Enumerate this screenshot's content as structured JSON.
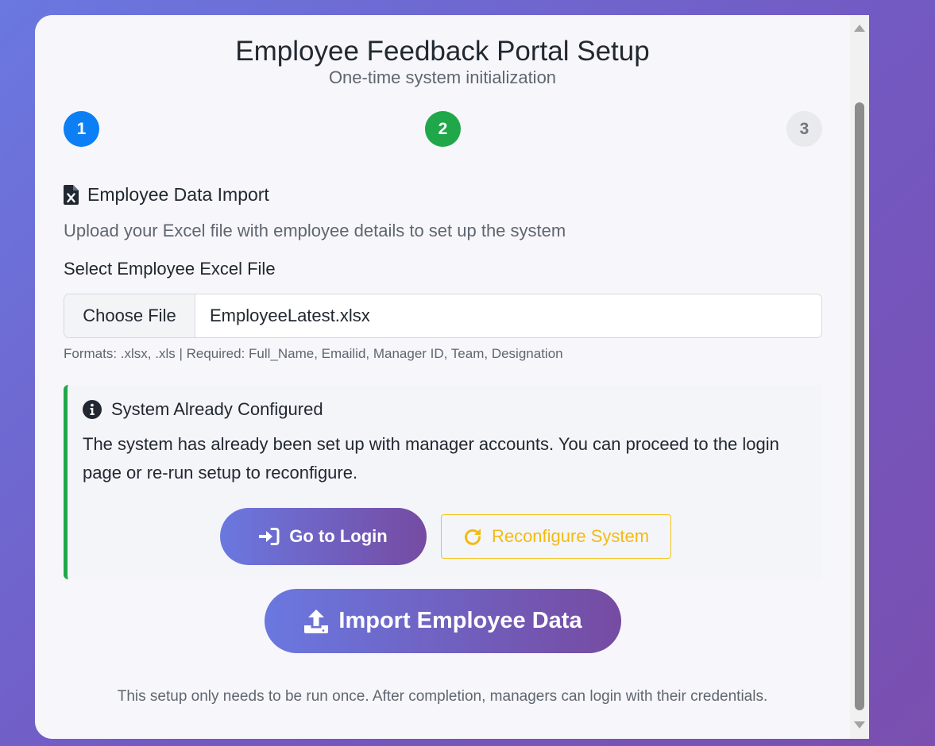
{
  "header": {
    "title": "Employee Feedback Portal Setup",
    "subtitle": "One-time system initialization"
  },
  "steps": [
    {
      "label": "1",
      "state": "active",
      "color": "#0d7ff5"
    },
    {
      "label": "2",
      "state": "completed",
      "color": "#20a74a"
    },
    {
      "label": "3",
      "state": "pending",
      "color": "#e8eaed"
    }
  ],
  "import_section": {
    "icon": "excel-file-icon",
    "heading": "Employee Data Import",
    "description": "Upload your Excel file with employee details to set up the system",
    "file_label": "Select Employee Excel File",
    "choose_file_label": "Choose File",
    "selected_file": "EmployeeLatest.xlsx",
    "hint": "Formats: .xlsx, .xls | Required: Full_Name, Emailid, Manager ID, Team, Designation"
  },
  "alert": {
    "icon": "info-circle-icon",
    "heading": "System Already Configured",
    "body": "The system has already been set up with manager accounts. You can proceed to the login page or re-run setup to reconfigure.",
    "login_button": "Go to Login",
    "login_icon": "sign-in-icon",
    "reconfigure_button": "Reconfigure System",
    "reconfigure_icon": "redo-icon",
    "accent_color": "#20a74a",
    "warning_color": "#f3bb10"
  },
  "import_button": {
    "label": "Import Employee Data",
    "icon": "upload-icon"
  },
  "footer": {
    "note": "This setup only needs to be run once. After completion, managers can login with their credentials."
  },
  "theme": {
    "gradient_start": "#6a78e0",
    "gradient_end": "#764ba2"
  }
}
